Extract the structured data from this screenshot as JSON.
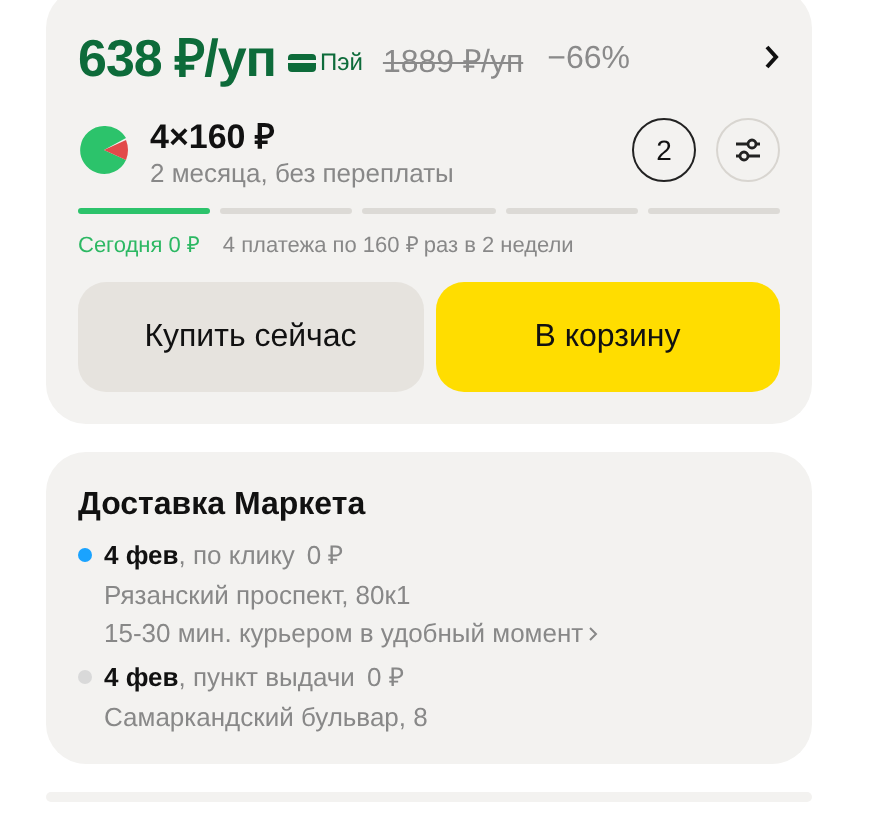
{
  "offer": {
    "price": "638 ₽/уп",
    "pay_badge": "Пэй",
    "old_price": "1889 ₽/уп",
    "discount": "−66%"
  },
  "installments": {
    "amount": "4×160 ₽",
    "terms": "2 месяца, без переплаты",
    "count": "2",
    "segments": [
      {
        "active": true
      },
      {
        "active": false
      },
      {
        "active": false
      },
      {
        "active": false
      },
      {
        "active": false
      }
    ],
    "today": "Сегодня 0 ₽",
    "schedule": "4 платежа по 160 ₽ раз в 2 недели"
  },
  "buttons": [
    {
      "label": "Купить сейчас",
      "kind": "secondary"
    },
    {
      "label": "В корзину",
      "kind": "primary"
    }
  ],
  "delivery": {
    "title": "Доставка Маркета",
    "options": [
      {
        "date": "**4 фев**, по клику",
        "price": "0 ₽",
        "color": "#1aa3ff",
        "lines": [
          "Рязанский проспект, 80к1"
        ],
        "link": "15-30 мин. курьером в удобный момент"
      },
      {
        "date": "**4 фев**, пункт выдачи",
        "price": "0 ₽",
        "color": "#d9d9d9",
        "lines": [
          "Самаркандский бульвар, 8"
        ]
      }
    ]
  }
}
